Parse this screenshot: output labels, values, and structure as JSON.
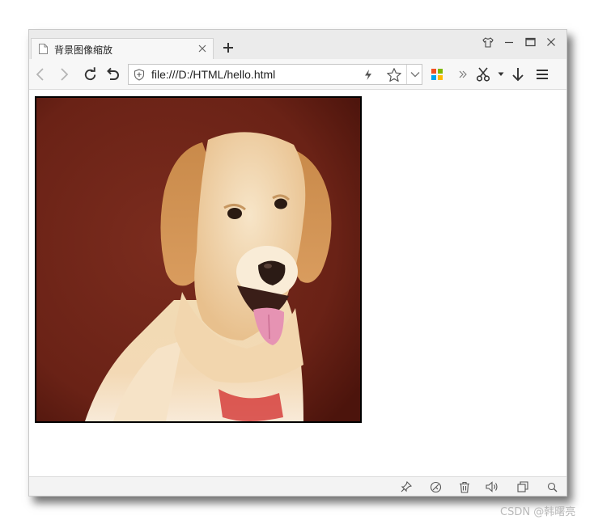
{
  "tab": {
    "title": "背景图像缩放"
  },
  "address_bar": {
    "url": "file:///D:/HTML/hello.html"
  },
  "page": {
    "image": {
      "subject": "golden retriever dog portrait"
    }
  },
  "watermark": "CSDN @韩曙亮",
  "colors": {
    "titlebar_bg": "#ebebeb",
    "toolbar_bg": "#f7f7f7",
    "image_background": "#6b2417",
    "icon": "#444444"
  }
}
